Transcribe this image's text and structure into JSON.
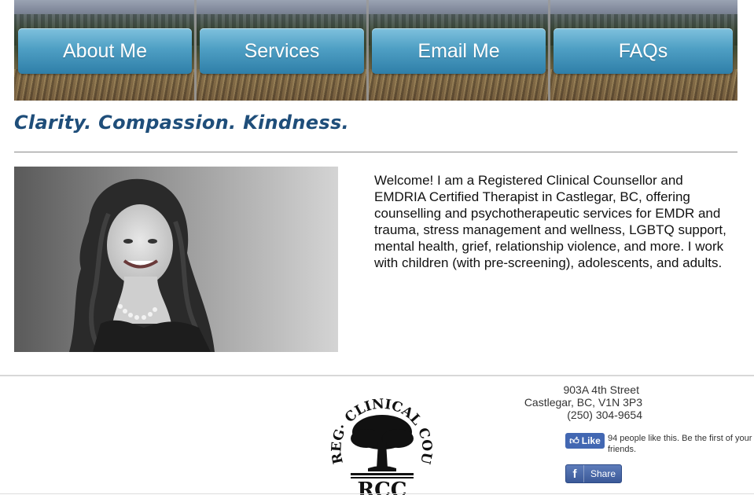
{
  "nav": {
    "items": [
      {
        "label": "About Me"
      },
      {
        "label": "Services"
      },
      {
        "label": "Email Me"
      },
      {
        "label": "FAQs"
      }
    ]
  },
  "tagline": "Clarity. Compassion. Kindness.",
  "welcome_text": "Welcome! I am a Registered Clinical Counsellor and EMDRIA Certified Therapist in Castlegar, BC, offering counselling and psychotherapeutic services for EMDR and trauma, stress management and wellness, LGBTQ support, mental health, grief, relationship violence, and more. I work with children (with pre-screening), adolescents, and adults.",
  "seal": {
    "text_left": "REG· CLINICAL COUNSELLOR",
    "bottom_text": "RCC"
  },
  "address": {
    "line1": "903A 4th Street",
    "line2": "Castlegar, BC, V1N 3P3",
    "phone": "(250) 304-9654"
  },
  "facebook": {
    "like_label": "Like",
    "like_text": "94 people like this. Be the first of your friends.",
    "share_label": "Share"
  },
  "colors": {
    "tagline": "#1f4e7a",
    "nav_button": "#4e9fc4",
    "facebook": "#4267b2"
  }
}
